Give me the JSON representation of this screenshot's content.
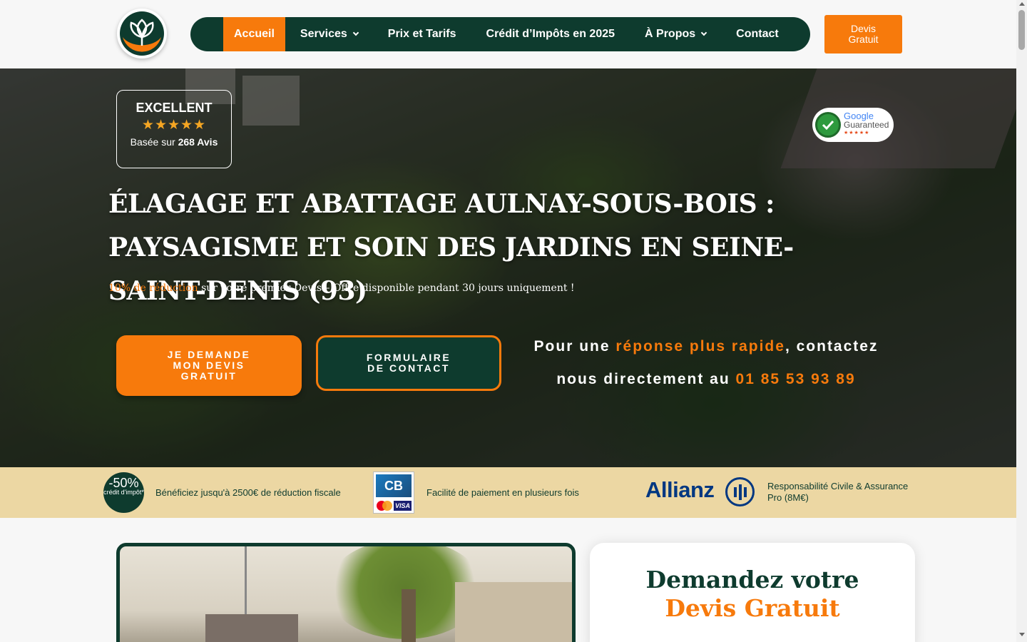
{
  "header": {
    "logo_name": "tree-logo",
    "nav": [
      {
        "label": "Accueil",
        "active": true,
        "dropdown": false
      },
      {
        "label": "Services",
        "active": false,
        "dropdown": true
      },
      {
        "label": "Prix et Tarifs",
        "active": false,
        "dropdown": false
      },
      {
        "label": "Crédit d’Impôts en 2025",
        "active": false,
        "dropdown": false
      },
      {
        "label": "À Propos",
        "active": false,
        "dropdown": true
      },
      {
        "label": "Contact",
        "active": false,
        "dropdown": false
      }
    ],
    "cta_label": "Devis Gratuit"
  },
  "hero": {
    "review": {
      "rating_label": "EXCELLENT",
      "stars": "★★★★★",
      "star_count": 5,
      "based_prefix": "Basée sur",
      "count_label": "268 Avis"
    },
    "badge": {
      "google": "Google",
      "guaranteed": "Guaranteed",
      "stars": "★★★★★"
    },
    "title": "ÉLAGAGE ET ABATTAGE AULNAY-SOUS-BOIS : PAYSAGISME ET SOIN DES JARDINS EN SEINE-SAINT-DENIS (93)",
    "offer_highlight": "10% de réduction",
    "offer_rest": " sur votre premier Devis – Offre disponible pendant 30 jours uniquement !",
    "primary_button": "JE DEMANDE MON DEVIS GRATUIT",
    "secondary_button": "FORMULAIRE DE CONTACT",
    "contact": {
      "part1": "Pour une ",
      "highlight": "réponse plus rapide",
      "part2": ", contactez nous directement au ",
      "phone": "01 85 53 93 89"
    }
  },
  "trust_strip": {
    "credit_badge_big": "-50%",
    "credit_badge_small": "crédit d'impôt*",
    "credit_text": "Bénéficiez jusqu'à 2500€ de réduction fiscale",
    "cb_label": "CB",
    "visa_label": "VISA",
    "payment_text": "Facilité de paiement en plusieurs fois",
    "allianz_label": "Allianz",
    "insurance_text": "Responsabilité Civile & Assurance Pro (8M€)"
  },
  "devis_card": {
    "line1": "Demandez votre",
    "line2": "Devis Gratuit"
  },
  "colors": {
    "brand_green": "#0e3b2e",
    "brand_orange": "#f77a0c",
    "strip_beige": "#ecd7a3"
  }
}
